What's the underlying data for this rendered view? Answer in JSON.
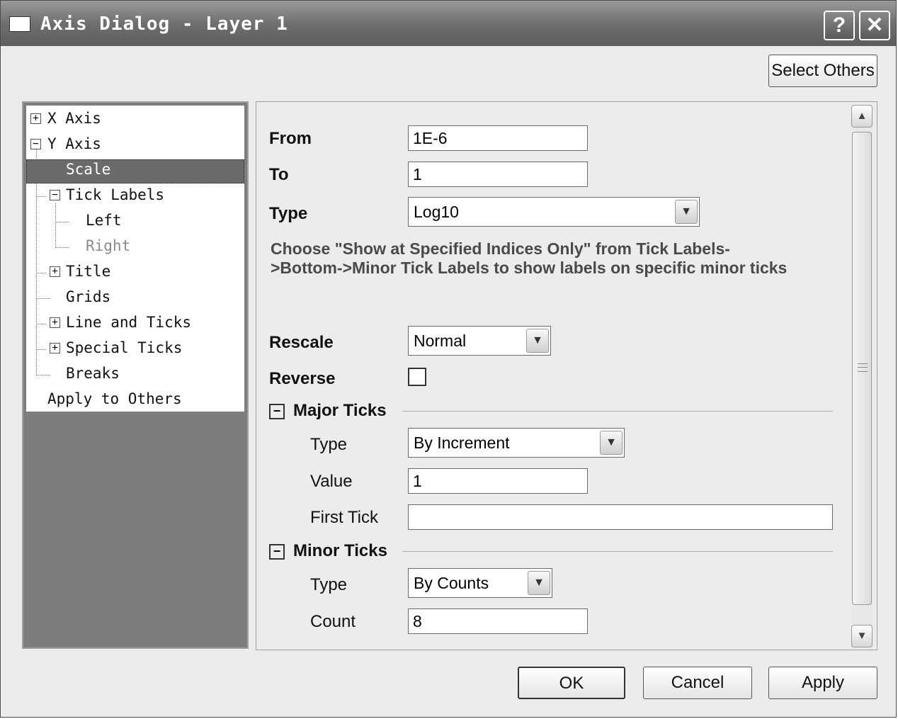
{
  "window": {
    "title": "Axis Dialog - Layer 1",
    "help_label": "?",
    "close_label": "✕"
  },
  "top": {
    "select_others_label": "Select Others"
  },
  "tree": {
    "x_axis": "X Axis",
    "y_axis": "Y Axis",
    "scale": "Scale",
    "tick_labels": "Tick Labels",
    "left": "Left",
    "right": "Right",
    "title": "Title",
    "grids": "Grids",
    "line_and_ticks": "Line and Ticks",
    "special_ticks": "Special Ticks",
    "breaks": "Breaks",
    "apply_to_others": "Apply to Others",
    "expand_symbol": "+",
    "collapse_symbol": "−"
  },
  "scale": {
    "from_label": "From",
    "from_value": "1E-6",
    "to_label": "To",
    "to_value": "1",
    "type_label": "Type",
    "type_value": "Log10",
    "info_text": "Choose \"Show at Specified Indices Only\" from Tick Labels->Bottom->Minor Tick Labels to show labels on specific minor ticks",
    "rescale_label": "Rescale",
    "rescale_value": "Normal",
    "reverse_label": "Reverse",
    "reverse_checked": false
  },
  "major_ticks": {
    "title": "Major Ticks",
    "type_label": "Type",
    "type_value": "By Increment",
    "value_label": "Value",
    "value_value": "1",
    "first_tick_label": "First Tick",
    "first_tick_value": ""
  },
  "minor_ticks": {
    "title": "Minor Ticks",
    "type_label": "Type",
    "type_value": "By Counts",
    "count_label": "Count",
    "count_value": "8"
  },
  "buttons": {
    "ok": "OK",
    "cancel": "Cancel",
    "apply": "Apply"
  },
  "icons": {
    "dropdown": "chevron-down-icon",
    "scroll_up": "arrow-up-icon",
    "scroll_down": "arrow-down-icon",
    "collapse": "minus-box-icon",
    "expand": "plus-box-icon"
  },
  "colors": {
    "titlebar": "#6f6f6f",
    "selection": "#6b6b6b",
    "dialog_bg": "#ececec",
    "info_text": "#4a4a4a"
  }
}
